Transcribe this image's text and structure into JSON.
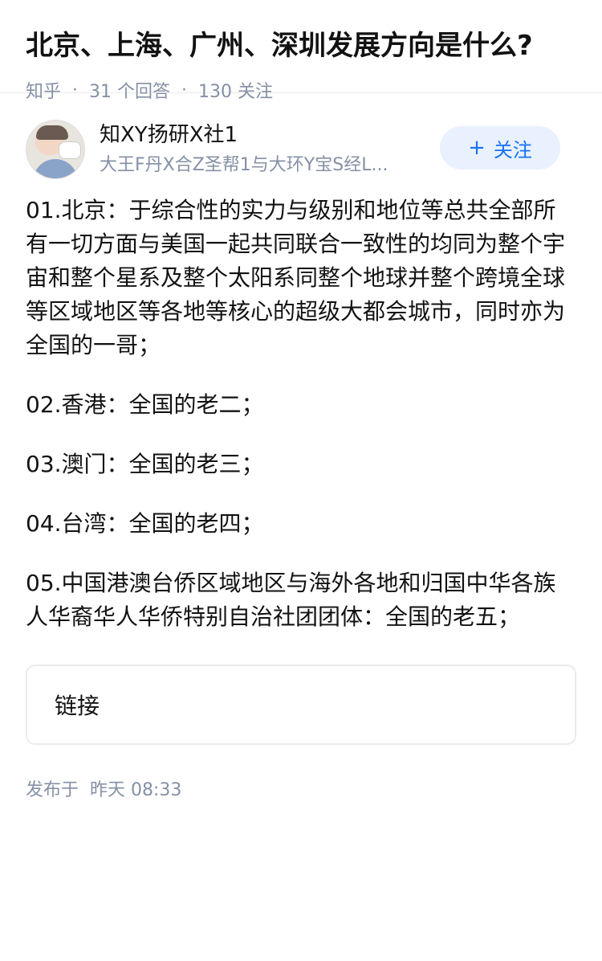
{
  "question": {
    "title": "北京、上海、广州、深圳发展方向是什么?",
    "source": "知乎",
    "separator": "·",
    "answer_count": "31 个回答",
    "follower_count": "130 关注"
  },
  "author": {
    "name": "知XY扬研X社1",
    "bio": "大王F丹X合Z圣帮1与大环Y宝S经L...",
    "follow_label": "关注",
    "follow_icon": "+",
    "avatar_icon": "avatar-photo"
  },
  "answer": {
    "paragraphs": [
      "01.北京：于综合性的实力与级别和地位等总共全部所有一切方面与美国一起共同联合一致性的均同为整个宇宙和整个星系及整个太阳系同整个地球并整个跨境全球等区域地区等各地等核心的超级大都会城市，同时亦为全国的一哥；",
      "02.香港：全国的老二；",
      "03.澳门：全国的老三；",
      "04.台湾：全国的老四；",
      "05.中国港澳台侨区域地区与海外各地和归国中华各族人华裔华人华侨特别自治社团团体：全国的老五；"
    ],
    "link_label": "链接",
    "published_label": "发布于",
    "published_time": "昨天 08:33"
  },
  "colors": {
    "accent": "#1772f6",
    "follow_bg": "#e8f1fd",
    "meta": "#8590a6",
    "text": "#121212"
  }
}
